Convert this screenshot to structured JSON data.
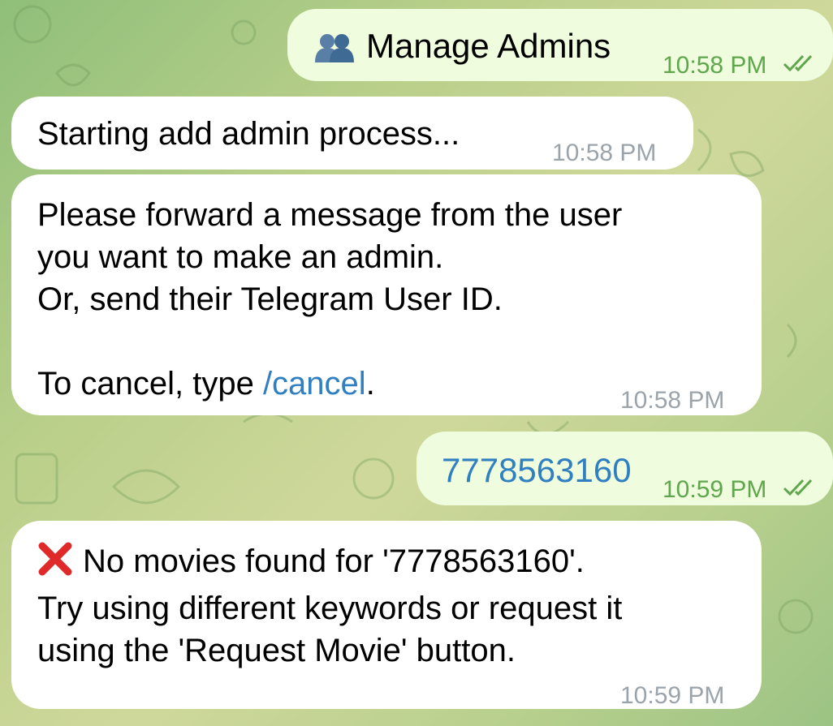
{
  "messages": [
    {
      "type": "outgoing",
      "icon": "busts-in-silhouette-icon",
      "text": "Manage Admins",
      "time": "10:58 PM",
      "status": "read"
    },
    {
      "type": "incoming",
      "text": "Starting add admin process...",
      "time": "10:58 PM"
    },
    {
      "type": "incoming",
      "lines": [
        "Please forward a message from the user",
        "you want to make an admin.",
        "Or, send their Telegram User ID.",
        "",
        "To cancel, type "
      ],
      "link": "/cancel",
      "after_link": ".",
      "time": "10:58 PM"
    },
    {
      "type": "outgoing",
      "text": "7778563160",
      "time": "10:59 PM",
      "status": "read"
    },
    {
      "type": "incoming",
      "icon": "cross-mark-icon",
      "lines": [
        "No movies found for '7778563160'.",
        "Try using different keywords or request it",
        "using the 'Request Movie' button."
      ],
      "time": "10:59 PM"
    }
  ],
  "colors": {
    "outgoing_bg": "#effdde",
    "incoming_bg": "#ffffff",
    "link": "#2f7fc1",
    "time_out": "#5fa64c",
    "time_in": "#9ba3ab",
    "cross": "#e02a2a"
  }
}
